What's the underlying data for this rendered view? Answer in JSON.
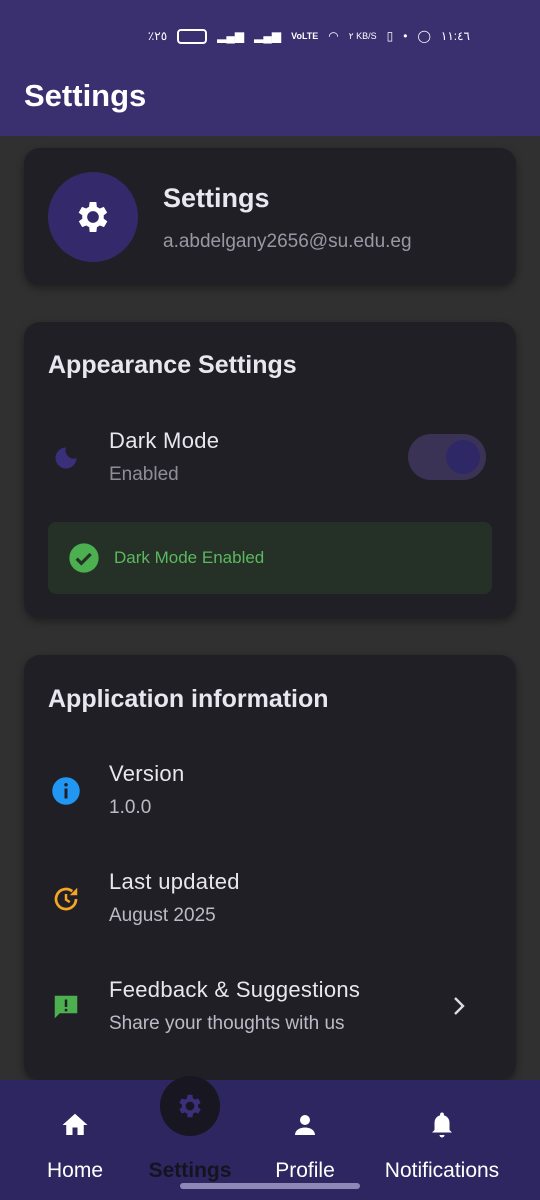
{
  "status_bar": {
    "battery": "٪٢٥",
    "network": "VoLTE",
    "speed": "٢ KB/S",
    "time": "١١:٤٦"
  },
  "header": {
    "title": "Settings"
  },
  "profile": {
    "title": "Settings",
    "email": "a.abdelgany2656@su.edu.eg",
    "icon": "gear-icon"
  },
  "appearance": {
    "title": "Appearance Settings",
    "dark_mode_label": "Dark Mode",
    "dark_mode_status": "Enabled",
    "dark_mode_on": true,
    "banner": "Dark Mode Enabled",
    "banner_color": "#5cb85f"
  },
  "app_info": {
    "title": "Application information",
    "items": [
      {
        "label": "Version",
        "value": "1.0.0",
        "icon": "info-icon",
        "color": "#2196f3"
      },
      {
        "label": "Last updated",
        "value": "August 2025",
        "icon": "update-icon",
        "color": "#f5a623"
      },
      {
        "label": "Feedback & Suggestions",
        "value": "Share your thoughts with us",
        "icon": "feedback-icon",
        "color": "#4caf50"
      }
    ]
  },
  "nav": {
    "items": [
      {
        "label": "Home"
      },
      {
        "label": "Settings",
        "active": true
      },
      {
        "label": "Profile"
      },
      {
        "label": "Notifications"
      }
    ]
  }
}
